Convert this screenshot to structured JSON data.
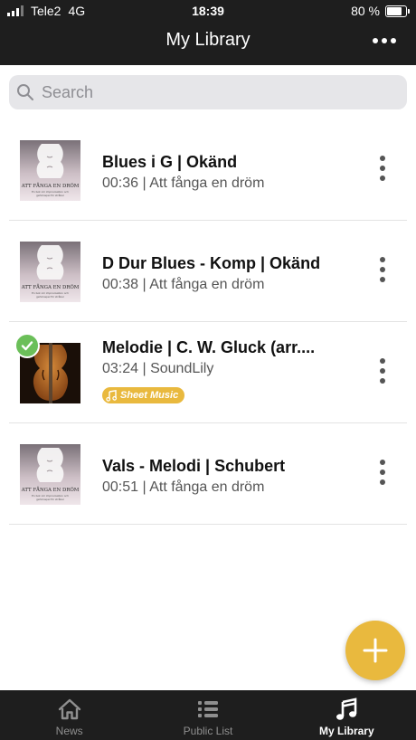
{
  "status_bar": {
    "carrier": "Tele2",
    "network": "4G",
    "time": "18:39",
    "battery_text": "80 %",
    "battery_level": 0.8
  },
  "header": {
    "title": "My Library",
    "more_icon": "ellipsis-icon"
  },
  "search": {
    "placeholder": "Search"
  },
  "tracks": [
    {
      "title": "Blues i G | Okänd",
      "subtitle": "00:36 | Att fånga en dröm",
      "artwork": "album-cover",
      "downloaded": false,
      "badge": ""
    },
    {
      "title": "D Dur Blues - Komp | Okänd",
      "subtitle": "00:38 | Att fånga en dröm",
      "artwork": "album-cover",
      "downloaded": false,
      "badge": ""
    },
    {
      "title": "Melodie | C. W. Gluck (arr....",
      "subtitle": "03:24 | SoundLily",
      "artwork": "violin-photo",
      "downloaded": true,
      "badge": "Sheet Music"
    },
    {
      "title": "Vals - Melodi | Schubert",
      "subtitle": "00:51 | Att fånga en dröm",
      "artwork": "album-cover",
      "downloaded": false,
      "badge": ""
    }
  ],
  "album_cover_text": {
    "title": "ATT FÅNGA EN DRÖM",
    "line1": "En bok om improvisation och",
    "line2": "gehörsspel för stråkar"
  },
  "fab": {
    "icon": "plus-icon"
  },
  "tabs": [
    {
      "label": "News",
      "icon": "home-icon",
      "active": false
    },
    {
      "label": "Public List",
      "icon": "list-icon",
      "active": false
    },
    {
      "label": "My Library",
      "icon": "music-note-icon",
      "active": true
    }
  ],
  "colors": {
    "bar_background": "#1e1e1e",
    "accent": "#e9b93e",
    "check_green": "#6bbf59",
    "search_background": "#e6e6e9"
  }
}
